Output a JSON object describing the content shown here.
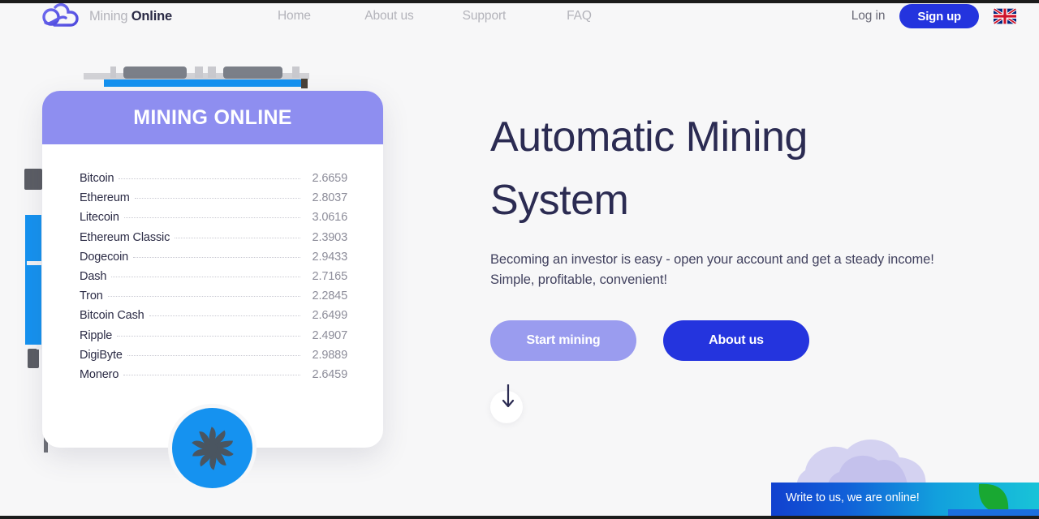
{
  "nav": {
    "brand_light": "Mining ",
    "brand_bold": "Online",
    "logo_icon": "cloud-infinity-logo",
    "links": [
      {
        "label": "Home"
      },
      {
        "label": "About us"
      },
      {
        "label": "Support"
      },
      {
        "label": "FAQ"
      }
    ],
    "login_label": "Log in",
    "signup_label": "Sign up",
    "flag_icon": "uk-flag-icon",
    "flag_colors": {
      "blue": "#00247d",
      "red": "#cf142b",
      "white": "#ffffff"
    }
  },
  "card": {
    "title": "MINING ONLINE",
    "header_color": "#8e8ef0",
    "fan_icon": "cooling-fan-icon",
    "fan_color": "#1592f0",
    "coins": [
      {
        "name": "Bitcoin",
        "value": "2.6659"
      },
      {
        "name": "Ethereum",
        "value": "2.8037"
      },
      {
        "name": "Litecoin",
        "value": "3.0616"
      },
      {
        "name": "Ethereum Classic",
        "value": "2.3903"
      },
      {
        "name": "Dogecoin",
        "value": "2.9433"
      },
      {
        "name": "Dash",
        "value": "2.7165"
      },
      {
        "name": "Tron",
        "value": "2.2845"
      },
      {
        "name": "Bitcoin Cash",
        "value": "2.6499"
      },
      {
        "name": "Ripple",
        "value": "2.4907"
      },
      {
        "name": "DigiByte",
        "value": "2.9889"
      },
      {
        "name": "Monero",
        "value": "2.6459"
      }
    ]
  },
  "hero": {
    "title_line1": "Automatic Mining",
    "title_line2": "System",
    "subtitle": "Becoming an investor is easy - open your account and get a steady income! Simple, profitable, convenient!",
    "primary_btn": "Start mining",
    "secondary_btn": "About us",
    "primary_color": "#9a9cef",
    "secondary_color": "#2434de",
    "scroll_icon": "arrow-down-icon"
  },
  "chat": {
    "message": "Write to us, we are online!",
    "leaf_icon": "green-leaf-icon",
    "leaf_color": "#19a832",
    "gradient_start": "#1141cf",
    "gradient_end": "#18c3d8"
  }
}
